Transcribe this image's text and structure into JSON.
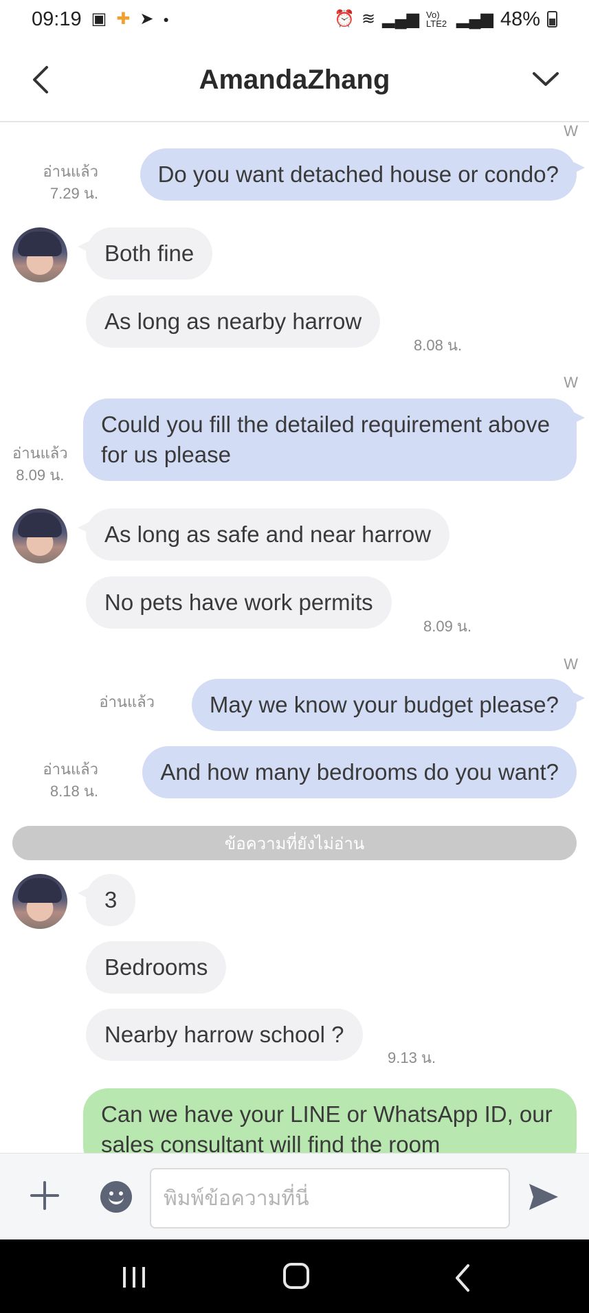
{
  "status_bar": {
    "time": "09:19",
    "network": "Vo) LTE2",
    "battery": "48%"
  },
  "header": {
    "title": "AmandaZhang"
  },
  "messages": [
    {
      "dir": "out",
      "sender_tag": "W",
      "text": "Do you want detached house or condo?",
      "read": "อ่านแล้ว",
      "time": "7.29 น."
    },
    {
      "dir": "in",
      "text": "Both fine"
    },
    {
      "dir": "in",
      "text": "As long as nearby harrow",
      "time": "8.08 น."
    },
    {
      "dir": "out",
      "sender_tag": "W",
      "text": "Could you fill the detailed requirement above for us please",
      "read": "อ่านแล้ว",
      "time": "8.09 น."
    },
    {
      "dir": "in",
      "text": "As long as safe and near harrow"
    },
    {
      "dir": "in",
      "text": "No pets have work permits",
      "time": "8.09 น."
    },
    {
      "dir": "out",
      "sender_tag": "W",
      "text": "May we know your budget please?",
      "read": "อ่านแล้ว"
    },
    {
      "dir": "out",
      "text": "And how many bedrooms do you want?",
      "read": "อ่านแล้ว",
      "time": "8.18 น."
    },
    {
      "dir": "in",
      "text": "3"
    },
    {
      "dir": "in",
      "text": "Bedrooms"
    },
    {
      "dir": "in",
      "text": "Nearby harrow school ?",
      "time": "9.13 น."
    },
    {
      "dir": "out",
      "text": "Can we have your LINE or WhatsApp ID, our sales consultant will find the room"
    }
  ],
  "unread_divider": "ข้อความที่ยังไม่อ่าน",
  "input": {
    "placeholder": "พิมพ์ข้อความที่นี่",
    "value": ""
  },
  "icons": {
    "back": "chevron-left-icon",
    "expand": "chevron-down-icon",
    "add": "plus-icon",
    "emoji": "emoji-icon",
    "send": "send-icon"
  },
  "colors": {
    "outgoing_bubble": "#d3dcf5",
    "incoming_bubble": "#f1f1f3",
    "highlight_bubble": "#b9e7b0",
    "send_icon": "#5d6475"
  }
}
